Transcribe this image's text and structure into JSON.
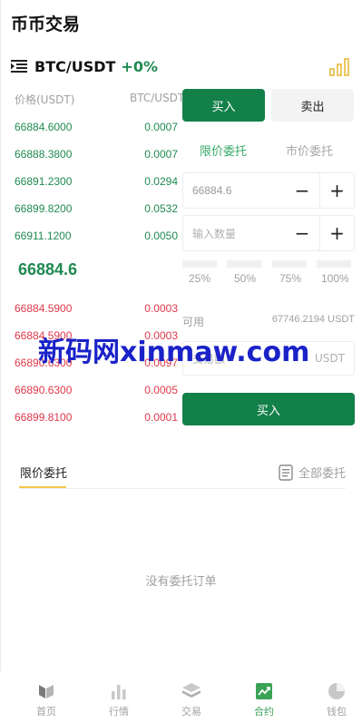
{
  "header": {
    "title": "币币交易"
  },
  "pair": {
    "name": "BTC/USDT",
    "change": "+0%"
  },
  "orderbook": {
    "price_header": "价格(USDT)",
    "amount_header": "BTC/USDT",
    "asks": [
      {
        "price": "66884.6000",
        "amount": "0.0007"
      },
      {
        "price": "66888.3800",
        "amount": "0.0007"
      },
      {
        "price": "66891.2300",
        "amount": "0.0294"
      },
      {
        "price": "66899.8200",
        "amount": "0.0532"
      },
      {
        "price": "66911.1200",
        "amount": "0.0050"
      }
    ],
    "last_price": "66884.6",
    "bids": [
      {
        "price": "66884.5900",
        "amount": "0.0003"
      },
      {
        "price": "66884.5900",
        "amount": "0.0003"
      },
      {
        "price": "66890.6300",
        "amount": "0.0097"
      },
      {
        "price": "66890.6300",
        "amount": "0.0005"
      },
      {
        "price": "66899.8100",
        "amount": "0.0001"
      }
    ]
  },
  "trade": {
    "buy_tab": "买入",
    "sell_tab": "卖出",
    "limit_order": "限价委托",
    "market_order": "市价委托",
    "price_value": "66884.6",
    "quantity_placeholder": "输入数量",
    "minus": "−",
    "plus": "+",
    "percents": [
      "25%",
      "50%",
      "75%",
      "100%"
    ],
    "available_label": "可用",
    "available_value": "67746.2194 USDT",
    "amount_label": "交易额",
    "amount_unit": "USDT",
    "submit_label": "买入"
  },
  "orders": {
    "tab_label": "限价委托",
    "all_label": "全部委托",
    "empty_text": "没有委托订单"
  },
  "watermark": {
    "text": "新码网xinmaw.com"
  },
  "tabbar": {
    "items": [
      {
        "label": "首页",
        "icon": "home-icon"
      },
      {
        "label": "行情",
        "icon": "market-icon"
      },
      {
        "label": "交易",
        "icon": "trade-icon"
      },
      {
        "label": "合约",
        "icon": "contract-icon"
      },
      {
        "label": "钱包",
        "icon": "wallet-icon"
      }
    ],
    "active_index": 3
  },
  "colors": {
    "accent_green": "#13804a",
    "ask_green": "#1f8a50",
    "bid_red": "#e0384a",
    "tab_active": "#3aa356",
    "underline_yellow": "#f2c94c"
  }
}
